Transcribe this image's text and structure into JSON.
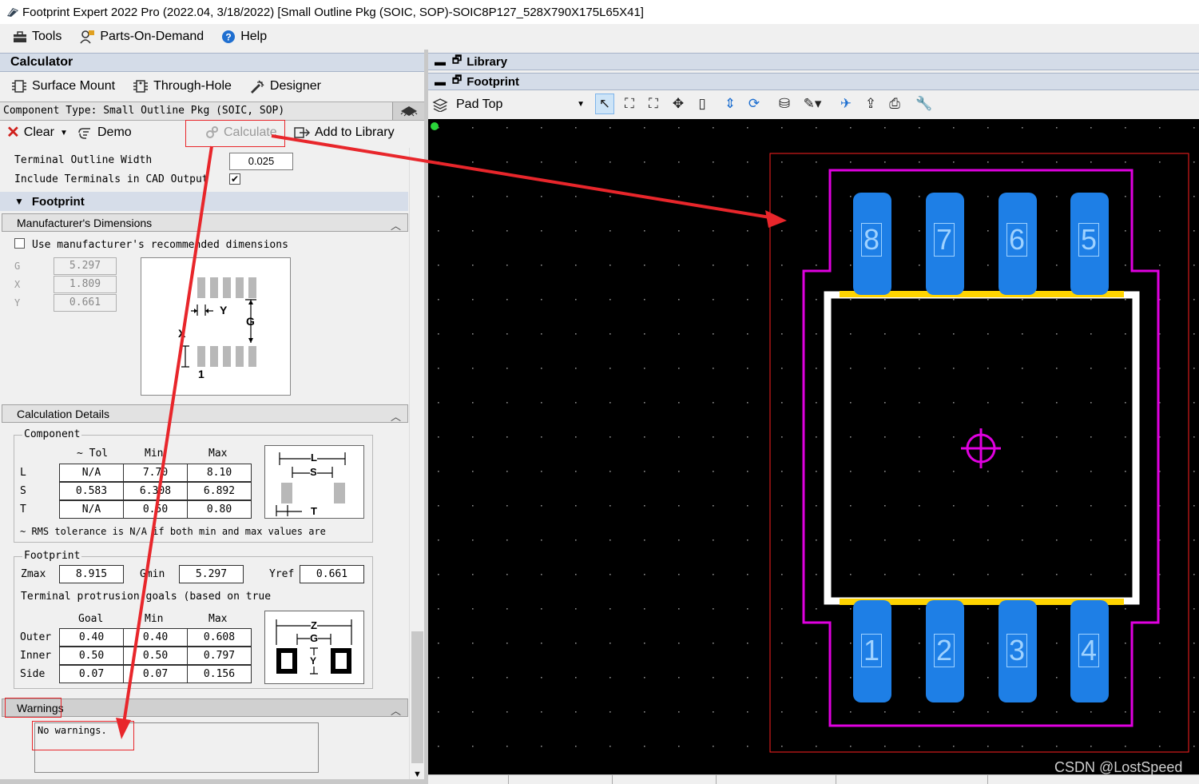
{
  "window": {
    "title": "Footprint Expert 2022 Pro (2022.04, 3/18/2022) [Small Outline Pkg (SOIC, SOP)-SOIC8P127_528X790X175L65X41]"
  },
  "menu": {
    "tools": "Tools",
    "parts_on_demand": "Parts-On-Demand",
    "help": "Help"
  },
  "calculator": {
    "title": "Calculator",
    "tabs": {
      "surface_mount": "Surface Mount",
      "through_hole": "Through-Hole",
      "designer": "Designer"
    },
    "component_type": "Component Type: Small Outline Pkg (SOIC, SOP)",
    "actions": {
      "clear": "Clear",
      "demo": "Demo",
      "calculate": "Calculate",
      "add_to_library": "Add to Library"
    },
    "terminal_outline_width": {
      "label": "Terminal Outline Width",
      "value": "0.025"
    },
    "include_terminals": {
      "label": "Include Terminals in CAD Output",
      "checked": true
    },
    "footprint_header": "Footprint",
    "manufacturer_dimensions": {
      "title": "Manufacturer's Dimensions",
      "use_recommended_label": "Use manufacturer's recommended dimensions",
      "use_recommended_checked": false,
      "fields": [
        {
          "label": "G",
          "value": "5.297"
        },
        {
          "label": "X",
          "value": "1.809"
        },
        {
          "label": "Y",
          "value": "0.661"
        }
      ],
      "diagram_labels": {
        "y": "Y",
        "g": "G",
        "x": "X",
        "pin1": "1"
      }
    },
    "calculation_details": {
      "title": "Calculation Details",
      "component": {
        "title": "Component",
        "headers": [
          "~ Tol",
          "Min",
          "Max"
        ],
        "rows": [
          {
            "label": "L",
            "tol": "N/A",
            "min": "7.70",
            "max": "8.10"
          },
          {
            "label": "S",
            "tol": "0.583",
            "min": "6.308",
            "max": "6.892"
          },
          {
            "label": "T",
            "tol": "N/A",
            "min": "0.50",
            "max": "0.80"
          }
        ],
        "note": "~ RMS tolerance is N/A if both min and max values are",
        "diagram_labels": {
          "l": "L",
          "s": "S",
          "t": "T"
        }
      },
      "footprint": {
        "title": "Footprint",
        "zmax": {
          "label": "Zmax",
          "value": "8.915"
        },
        "gmin": {
          "label": "Gmin",
          "value": "5.297"
        },
        "yref": {
          "label": "Yref",
          "value": "0.661"
        },
        "goals_note": "Terminal protrusion goals (based on true",
        "headers": [
          "Goal",
          "Min",
          "Max"
        ],
        "rows": [
          {
            "label": "Outer",
            "goal": "0.40",
            "min": "0.40",
            "max": "0.608"
          },
          {
            "label": "Inner",
            "goal": "0.50",
            "min": "0.50",
            "max": "0.797"
          },
          {
            "label": "Side",
            "goal": "0.07",
            "min": "0.07",
            "max": "0.156"
          }
        ],
        "diagram_labels": {
          "z": "Z",
          "g": "G",
          "y": "Y"
        }
      }
    },
    "warnings": {
      "title": "Warnings",
      "text": "No warnings."
    }
  },
  "library_panel": {
    "title": "Library"
  },
  "footprint_panel": {
    "title": "Footprint",
    "layer_select": "Pad Top",
    "pads_top": [
      "8",
      "7",
      "6",
      "5"
    ],
    "pads_bottom": [
      "1",
      "2",
      "3",
      "4"
    ]
  },
  "watermark": "CSDN @LostSpeed",
  "colors": {
    "canvas_bg": "#000000",
    "pad": "#1e7fe6",
    "courtyard": "#e000e0",
    "silkscreen": "#ffffff",
    "assembly": "#ffd400",
    "annotation": "#e8262b"
  }
}
